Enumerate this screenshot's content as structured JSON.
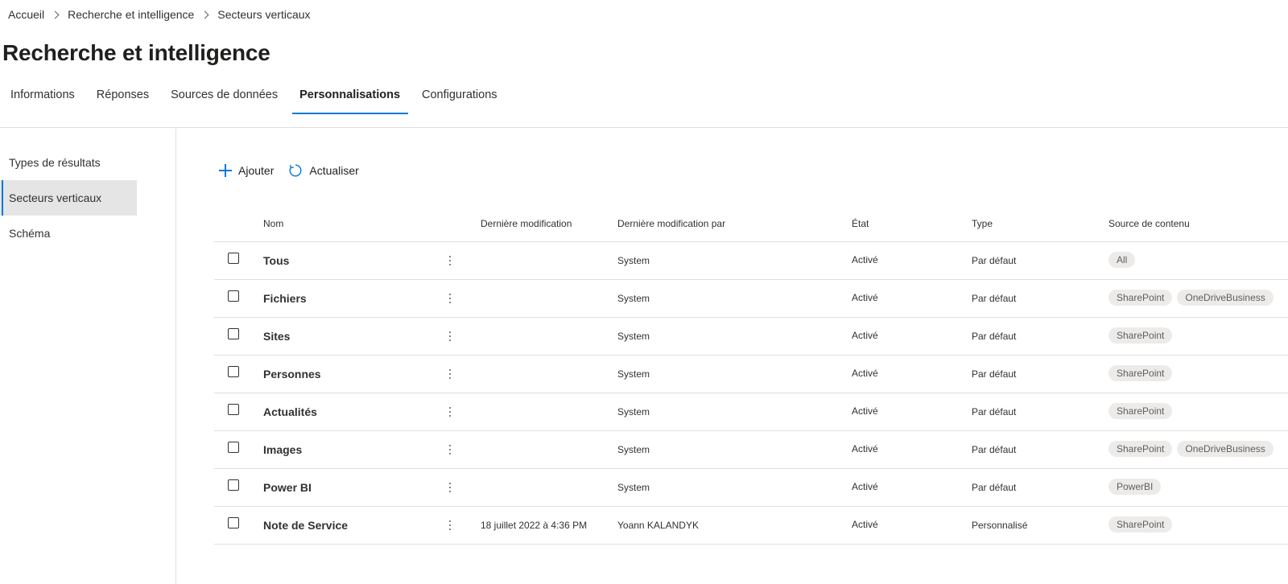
{
  "breadcrumb": [
    "Accueil",
    "Recherche et intelligence",
    "Secteurs verticaux"
  ],
  "page_title": "Recherche et intelligence",
  "tabs": [
    {
      "label": "Informations",
      "active": false
    },
    {
      "label": "Réponses",
      "active": false
    },
    {
      "label": "Sources de données",
      "active": false
    },
    {
      "label": "Personnalisations",
      "active": true
    },
    {
      "label": "Configurations",
      "active": false
    }
  ],
  "left_nav": [
    {
      "label": "Types de résultats",
      "active": false
    },
    {
      "label": "Secteurs verticaux",
      "active": true
    },
    {
      "label": "Schéma",
      "active": false
    }
  ],
  "toolbar": {
    "add_label": "Ajouter",
    "refresh_label": "Actualiser"
  },
  "table": {
    "headers": {
      "name": "Nom",
      "modified": "Dernière modification",
      "modified_by": "Dernière modification par",
      "state": "État",
      "type": "Type",
      "source": "Source de contenu"
    },
    "rows": [
      {
        "name": "Tous",
        "modified": "",
        "modified_by": "System",
        "state": "Activé",
        "type": "Par défaut",
        "sources": [
          "All"
        ]
      },
      {
        "name": "Fichiers",
        "modified": "",
        "modified_by": "System",
        "state": "Activé",
        "type": "Par défaut",
        "sources": [
          "SharePoint",
          "OneDriveBusiness"
        ]
      },
      {
        "name": "Sites",
        "modified": "",
        "modified_by": "System",
        "state": "Activé",
        "type": "Par défaut",
        "sources": [
          "SharePoint"
        ]
      },
      {
        "name": "Personnes",
        "modified": "",
        "modified_by": "System",
        "state": "Activé",
        "type": "Par défaut",
        "sources": [
          "SharePoint"
        ]
      },
      {
        "name": "Actualités",
        "modified": "",
        "modified_by": "System",
        "state": "Activé",
        "type": "Par défaut",
        "sources": [
          "SharePoint"
        ]
      },
      {
        "name": "Images",
        "modified": "",
        "modified_by": "System",
        "state": "Activé",
        "type": "Par défaut",
        "sources": [
          "SharePoint",
          "OneDriveBusiness"
        ]
      },
      {
        "name": "Power BI",
        "modified": "",
        "modified_by": "System",
        "state": "Activé",
        "type": "Par défaut",
        "sources": [
          "PowerBI"
        ]
      },
      {
        "name": "Note de Service",
        "modified": "18 juillet 2022 à 4:36 PM",
        "modified_by": "Yoann KALANDYK",
        "state": "Activé",
        "type": "Personnalisé",
        "sources": [
          "SharePoint"
        ]
      }
    ]
  },
  "colors": {
    "accent": "#0078d4",
    "chip_bg": "#edebe9"
  }
}
